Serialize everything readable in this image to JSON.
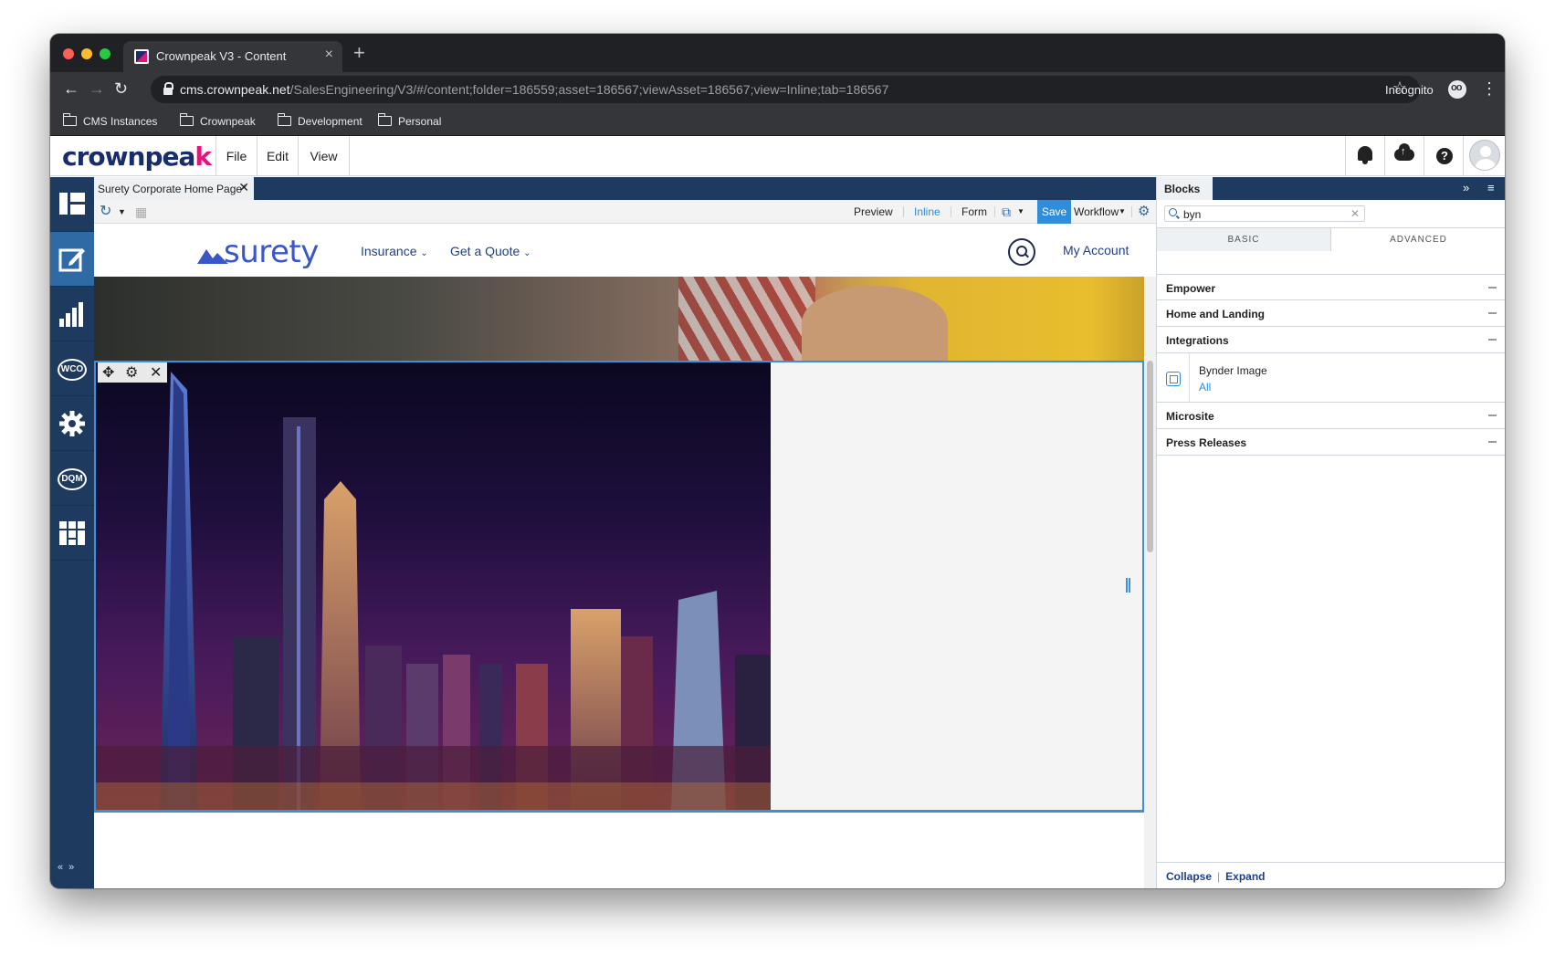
{
  "browser": {
    "tab_title": "Crownpeak V3 - Content",
    "url_host": "cms.crownpeak.net",
    "url_path": "/SalesEngineering/V3/#/content;folder=186559;asset=186567;viewAsset=186567;view=Inline;tab=186567",
    "incognito_label": "Incognito",
    "bookmarks": [
      "CMS Instances",
      "Crownpeak",
      "Development",
      "Personal"
    ]
  },
  "app": {
    "logo_text": "crownpea",
    "logo_accent": "k",
    "menu": [
      "File",
      "Edit",
      "View"
    ]
  },
  "left_nav": {
    "items": [
      "dashboard-icon",
      "edit-content-icon",
      "reports-icon",
      "wco-icon",
      "settings-icon",
      "dqm-icon",
      "apps-icon"
    ],
    "wco_label": "WCO",
    "dqm_label": "DQM",
    "collapse_arrows": "«»"
  },
  "document": {
    "tab_label": "Surety Corporate Home Page*",
    "toolbar": {
      "preview": "Preview",
      "inline": "Inline",
      "form": "Form",
      "save": "Save",
      "workflow": "Workflow"
    }
  },
  "site": {
    "logo": "surety",
    "nav": [
      "Insurance",
      "Get a Quote"
    ],
    "account": "My Account"
  },
  "blocks_panel": {
    "title": "Blocks",
    "search_value": "byn",
    "tabs": [
      "BASIC",
      "ADVANCED"
    ],
    "groups": [
      "Empower",
      "Home and Landing",
      "Integrations",
      "Microsite",
      "Press Releases"
    ],
    "item": {
      "name": "Bynder Image",
      "link": "All"
    },
    "footer": {
      "collapse": "Collapse",
      "expand": "Expand"
    }
  },
  "colors": {
    "nav_bg": "#1e3a5f",
    "nav_active": "#2f6aa5",
    "accent": "#2f8ddb",
    "brand_pink": "#e3157a",
    "selection_border": "#3d8fd6"
  }
}
